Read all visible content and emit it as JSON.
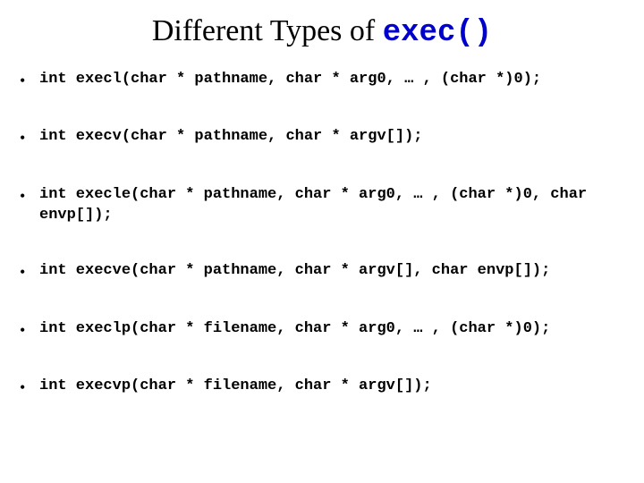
{
  "title": {
    "prefix": "Different Types of ",
    "exec": "exec()"
  },
  "signatures": [
    "int execl(char * pathname, char * arg0, … , (char *)0);",
    "int execv(char * pathname, char * argv[]);",
    "int execle(char * pathname, char * arg0, … , (char *)0, char envp[]);",
    "int execve(char * pathname, char * argv[], char envp[]);",
    "int execlp(char * filename, char * arg0, … , (char *)0);",
    "int execvp(char * filename, char * argv[]);"
  ]
}
